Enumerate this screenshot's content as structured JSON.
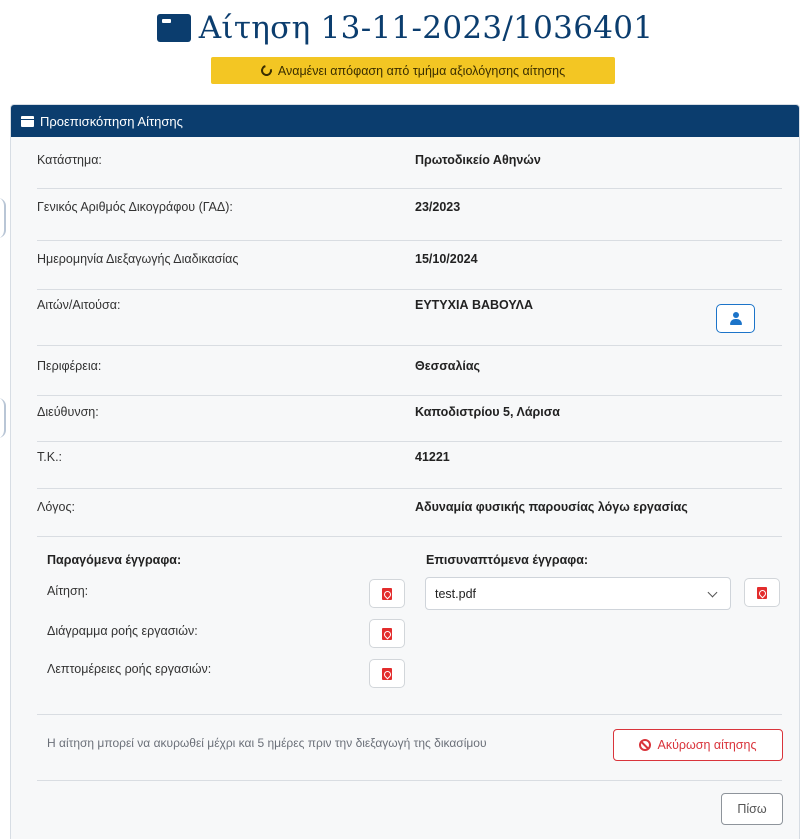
{
  "page": {
    "title": "Αίτηση 13-11-2023/1036401",
    "status": "Αναμένει απόφαση από τμήμα αξιολόγησης αίτησης"
  },
  "card": {
    "header": "Προεπισκόπηση Αίτησης"
  },
  "fields": [
    {
      "label": "Κατάστημα:",
      "value": "Πρωτοδικείο Αθηνών"
    },
    {
      "label": "Γενικός Αριθμός Δικογράφου (ΓΑΔ):",
      "value": "23/2023"
    },
    {
      "label": "Ημερομηνία Διεξαγωγής Διαδικασίας",
      "value": "15/10/2024"
    },
    {
      "label": "Αιτών/Αιτούσα:",
      "value": "ΕΥΤΥΧΙΑ ΒΑΒΟΥΛΑ"
    },
    {
      "label": "Περιφέρεια:",
      "value": "Θεσσαλίας"
    },
    {
      "label": "Διεύθυνση:",
      "value": "Καποδιστρίου 5, Λάρισα"
    },
    {
      "label": "Τ.Κ.:",
      "value": "41221"
    },
    {
      "label": "Λόγος:",
      "value": "Αδυναμία φυσικής παρουσίας λόγω εργασίας"
    }
  ],
  "documents": {
    "generated_title": "Παραγόμενα έγγραφα:",
    "generated": [
      {
        "label": "Αίτηση:"
      },
      {
        "label": "Διάγραμμα ροής εργασιών:"
      },
      {
        "label": "Λεπτομέρειες ροής εργασιών:"
      }
    ],
    "attached_title": "Επισυναπτόμενα έγγραφα:",
    "attached_selected": "test.pdf"
  },
  "footer": {
    "note": "Η αίτηση μπορεί να ακυρωθεί μέχρι και 5 ημέρες πριν την διεξαγωγή της δικασίμου",
    "cancel_label": "Ακύρωση αίτησης",
    "back_label": "Πίσω"
  },
  "colors": {
    "primary": "#0b3d6e",
    "status_badge": "#f3c623",
    "accent_blue": "#1c74c9",
    "danger": "#d9343b",
    "pdf_red": "#e32d2d"
  }
}
